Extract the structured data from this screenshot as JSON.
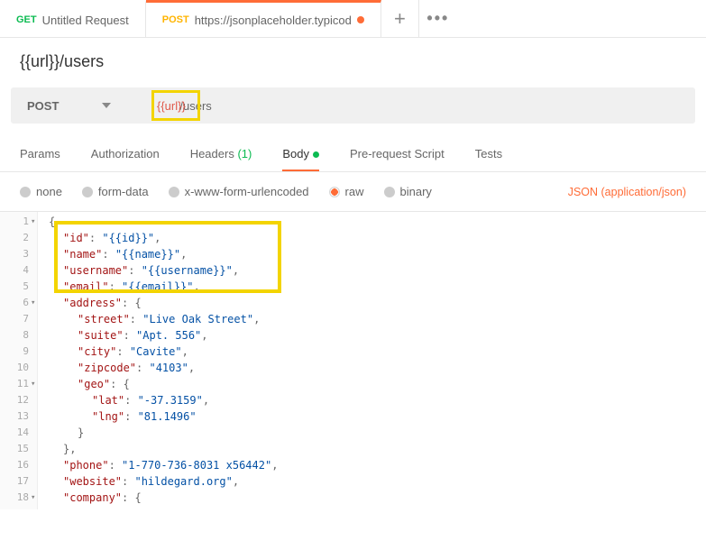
{
  "tabs": [
    {
      "method": "GET",
      "title": "Untitled Request",
      "active": false,
      "dirty": false
    },
    {
      "method": "POST",
      "title": "https://jsonplaceholder.typicod",
      "active": true,
      "dirty": true
    }
  ],
  "requestPath": "{{url}}/users",
  "method": "POST",
  "urlVar": "{{url}}",
  "urlRest": "/users",
  "subTabs": {
    "params": "Params",
    "auth": "Authorization",
    "headers": "Headers",
    "headersCount": "(1)",
    "body": "Body",
    "prerequest": "Pre-request Script",
    "tests": "Tests"
  },
  "bodyOptions": {
    "none": "none",
    "formdata": "form-data",
    "urlencoded": "x-www-form-urlencoded",
    "raw": "raw",
    "binary": "binary"
  },
  "contentType": "JSON (application/json)",
  "code": [
    {
      "n": "1",
      "fold": "▾",
      "indent": 0,
      "tokens": [
        {
          "t": "punc",
          "v": "{"
        }
      ]
    },
    {
      "n": "2",
      "indent": 1,
      "tokens": [
        {
          "t": "key",
          "v": "\"id\""
        },
        {
          "t": "punc",
          "v": ": "
        },
        {
          "t": "str",
          "v": "\"{{id}}\""
        },
        {
          "t": "punc",
          "v": ","
        }
      ]
    },
    {
      "n": "3",
      "indent": 1,
      "tokens": [
        {
          "t": "key",
          "v": "\"name\""
        },
        {
          "t": "punc",
          "v": ": "
        },
        {
          "t": "str",
          "v": "\"{{name}}\""
        },
        {
          "t": "punc",
          "v": ","
        }
      ]
    },
    {
      "n": "4",
      "indent": 1,
      "tokens": [
        {
          "t": "key",
          "v": "\"username\""
        },
        {
          "t": "punc",
          "v": ": "
        },
        {
          "t": "str",
          "v": "\"{{username}}\""
        },
        {
          "t": "punc",
          "v": ","
        }
      ]
    },
    {
      "n": "5",
      "indent": 1,
      "tokens": [
        {
          "t": "key",
          "v": "\"email\""
        },
        {
          "t": "punc",
          "v": ": "
        },
        {
          "t": "str",
          "v": "\"{{email}}\""
        },
        {
          "t": "punc",
          "v": ","
        }
      ]
    },
    {
      "n": "6",
      "fold": "▾",
      "indent": 1,
      "tokens": [
        {
          "t": "key",
          "v": "\"address\""
        },
        {
          "t": "punc",
          "v": ": {"
        }
      ]
    },
    {
      "n": "7",
      "indent": 2,
      "tokens": [
        {
          "t": "key",
          "v": "\"street\""
        },
        {
          "t": "punc",
          "v": ": "
        },
        {
          "t": "str",
          "v": "\"Live Oak Street\""
        },
        {
          "t": "punc",
          "v": ","
        }
      ]
    },
    {
      "n": "8",
      "indent": 2,
      "tokens": [
        {
          "t": "key",
          "v": "\"suite\""
        },
        {
          "t": "punc",
          "v": ": "
        },
        {
          "t": "str",
          "v": "\"Apt. 556\""
        },
        {
          "t": "punc",
          "v": ","
        }
      ]
    },
    {
      "n": "9",
      "indent": 2,
      "tokens": [
        {
          "t": "key",
          "v": "\"city\""
        },
        {
          "t": "punc",
          "v": ": "
        },
        {
          "t": "str",
          "v": "\"Cavite\""
        },
        {
          "t": "punc",
          "v": ","
        }
      ]
    },
    {
      "n": "10",
      "indent": 2,
      "tokens": [
        {
          "t": "key",
          "v": "\"zipcode\""
        },
        {
          "t": "punc",
          "v": ": "
        },
        {
          "t": "str",
          "v": "\"4103\""
        },
        {
          "t": "punc",
          "v": ","
        }
      ]
    },
    {
      "n": "11",
      "fold": "▾",
      "indent": 2,
      "tokens": [
        {
          "t": "key",
          "v": "\"geo\""
        },
        {
          "t": "punc",
          "v": ": {"
        }
      ]
    },
    {
      "n": "12",
      "indent": 3,
      "tokens": [
        {
          "t": "key",
          "v": "\"lat\""
        },
        {
          "t": "punc",
          "v": ": "
        },
        {
          "t": "str",
          "v": "\"-37.3159\""
        },
        {
          "t": "punc",
          "v": ","
        }
      ]
    },
    {
      "n": "13",
      "indent": 3,
      "tokens": [
        {
          "t": "key",
          "v": "\"lng\""
        },
        {
          "t": "punc",
          "v": ": "
        },
        {
          "t": "str",
          "v": "\"81.1496\""
        }
      ]
    },
    {
      "n": "14",
      "indent": 2,
      "tokens": [
        {
          "t": "punc",
          "v": "}"
        }
      ]
    },
    {
      "n": "15",
      "indent": 1,
      "tokens": [
        {
          "t": "punc",
          "v": "},"
        }
      ]
    },
    {
      "n": "16",
      "indent": 1,
      "tokens": [
        {
          "t": "key",
          "v": "\"phone\""
        },
        {
          "t": "punc",
          "v": ": "
        },
        {
          "t": "str",
          "v": "\"1-770-736-8031 x56442\""
        },
        {
          "t": "punc",
          "v": ","
        }
      ]
    },
    {
      "n": "17",
      "indent": 1,
      "tokens": [
        {
          "t": "key",
          "v": "\"website\""
        },
        {
          "t": "punc",
          "v": ": "
        },
        {
          "t": "str",
          "v": "\"hildegard.org\""
        },
        {
          "t": "punc",
          "v": ","
        }
      ]
    },
    {
      "n": "18",
      "fold": "▾",
      "indent": 1,
      "tokens": [
        {
          "t": "key",
          "v": "\"company\""
        },
        {
          "t": "punc",
          "v": ": {"
        }
      ]
    }
  ]
}
